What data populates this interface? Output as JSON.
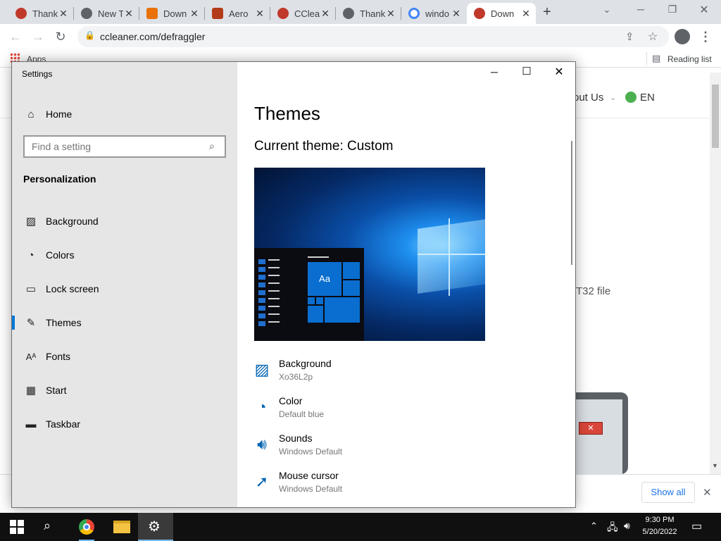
{
  "browser": {
    "tabs": [
      {
        "title": "Thank",
        "fav_color": "#c0392b"
      },
      {
        "title": "New T",
        "fav_color": "#5f6368"
      },
      {
        "title": "Down",
        "fav_color": "#e8710a"
      },
      {
        "title": "Aero",
        "fav_color": "#b23b1a"
      },
      {
        "title": "CClea",
        "fav_color": "#c0392b"
      },
      {
        "title": "Thank",
        "fav_color": "#5f6368"
      },
      {
        "title": "windo",
        "fav_color": "#4285f4"
      },
      {
        "title": "Down",
        "fav_color": "#c0392b"
      }
    ],
    "new_tab_glyph": "+",
    "url": "ccleaner.com/defraggler",
    "apps_label": "Apps",
    "reading_list_label": "Reading list"
  },
  "webpage": {
    "nav_about": "out Us",
    "nav_lang": "EN",
    "body_fragment": "T32 file"
  },
  "download_bar": {
    "show_all_label": "Show all"
  },
  "settings": {
    "window_title": "Settings",
    "home_label": "Home",
    "search_placeholder": "Find a setting",
    "section_title": "Personalization",
    "nav": [
      {
        "label": "Background",
        "icon": "picture-icon"
      },
      {
        "label": "Colors",
        "icon": "palette-icon"
      },
      {
        "label": "Lock screen",
        "icon": "lock-screen-icon"
      },
      {
        "label": "Themes",
        "icon": "brush-icon"
      },
      {
        "label": "Fonts",
        "icon": "fonts-icon"
      },
      {
        "label": "Start",
        "icon": "start-icon"
      },
      {
        "label": "Taskbar",
        "icon": "taskbar-icon"
      }
    ],
    "selected_nav": "Themes",
    "page_title": "Themes",
    "current_theme": "Current theme: Custom",
    "preview_tile_text": "Aa",
    "properties": [
      {
        "title": "Background",
        "value": "Xo36L2p",
        "icon": "picture-icon"
      },
      {
        "title": "Color",
        "value": "Default blue",
        "icon": "palette-icon"
      },
      {
        "title": "Sounds",
        "value": "Windows Default",
        "icon": "speaker-icon"
      },
      {
        "title": "Mouse cursor",
        "value": "Windows Default",
        "icon": "cursor-icon"
      }
    ],
    "accent_color": "#0078d7"
  },
  "taskbar": {
    "time": "9:30 PM",
    "date": "5/20/2022"
  }
}
